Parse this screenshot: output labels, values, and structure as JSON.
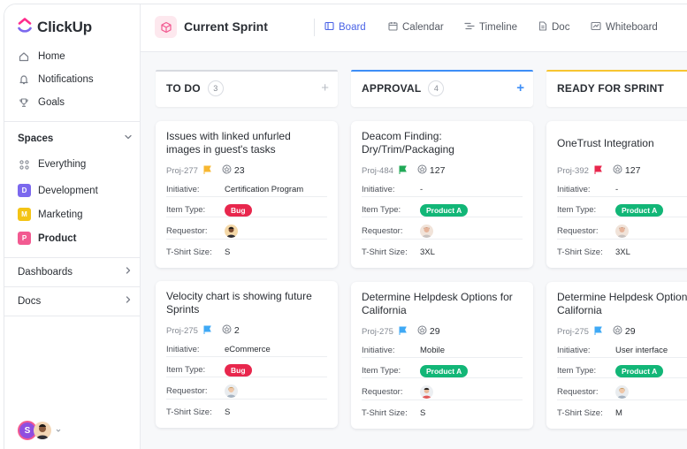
{
  "app": {
    "name": "ClickUp"
  },
  "sidebar": {
    "nav": [
      {
        "label": "Home",
        "icon": "home-icon"
      },
      {
        "label": "Notifications",
        "icon": "bell-icon"
      },
      {
        "label": "Goals",
        "icon": "trophy-icon"
      }
    ],
    "spaces_label": "Spaces",
    "spaces": [
      {
        "label": "Everything",
        "icon": "grid-icon"
      },
      {
        "label": "Development",
        "badge": "D",
        "color": "#7b68ee"
      },
      {
        "label": "Marketing",
        "badge": "M",
        "color": "#f4c415"
      },
      {
        "label": "Product",
        "badge": "P",
        "color": "#f25a91"
      }
    ],
    "dashboards_label": "Dashboards",
    "docs_label": "Docs",
    "user_badge": "S"
  },
  "header": {
    "title": "Current Sprint",
    "views": [
      {
        "label": "Board",
        "active": true
      },
      {
        "label": "Calendar",
        "active": false
      },
      {
        "label": "Timeline",
        "active": false
      },
      {
        "label": "Doc",
        "active": false
      },
      {
        "label": "Whiteboard",
        "active": false
      }
    ]
  },
  "columns": [
    {
      "title": "TO DO",
      "count": "3",
      "bar_color": "#d7dae0",
      "plus": "+",
      "plus_color": "#b9bdc5"
    },
    {
      "title": "APPROVAL",
      "count": "4",
      "bar_color": "#3d8ef7",
      "plus": "+",
      "plus_color": "#3d8ef7"
    },
    {
      "title": "READY FOR SPRINT",
      "bar_color": "#f7c531"
    }
  ],
  "field_labels": {
    "initiative": "Initiative:",
    "item_type": "Item Type:",
    "requestor": "Requestor:",
    "size": "T-Shirt Size:"
  },
  "cards": [
    {
      "title": "Issues with linked unfurled images in guest's tasks",
      "id": "Proj-277",
      "flag_color": "#f7b731",
      "points": "23",
      "initiative": "Certification Program",
      "type": "Bug",
      "type_color": "#e8274d",
      "size": "S"
    },
    {
      "title": "Deacom Finding: Dry/Trim/Packaging",
      "id": "Proj-484",
      "flag_color": "#21a957",
      "points": "127",
      "initiative": "-",
      "type": "Product A",
      "type_color": "#12b677",
      "size": "3XL"
    },
    {
      "title": "OneTrust Integration",
      "id": "Proj-392",
      "flag_color": "#e8274d",
      "points": "127",
      "initiative": "-",
      "type": "Product A",
      "type_color": "#12b677",
      "size": "3XL"
    },
    {
      "title": "Velocity chart is showing future Sprints",
      "id": "Proj-275",
      "flag_color": "#3fa9f5",
      "points": "2",
      "initiative": "eCommerce",
      "type": "Bug",
      "type_color": "#e8274d",
      "size": "S"
    },
    {
      "title": "Determine Helpdesk Options for California",
      "id": "Proj-275",
      "flag_color": "#3fa9f5",
      "points": "29",
      "initiative": "Mobile",
      "type": "Product A",
      "type_color": "#12b677",
      "size": "S"
    },
    {
      "title": "Determine Helpdesk Options for California",
      "id": "Proj-275",
      "flag_color": "#3fa9f5",
      "points": "29",
      "initiative": "User interface",
      "type": "Product A",
      "type_color": "#12b677",
      "size": "M"
    }
  ]
}
